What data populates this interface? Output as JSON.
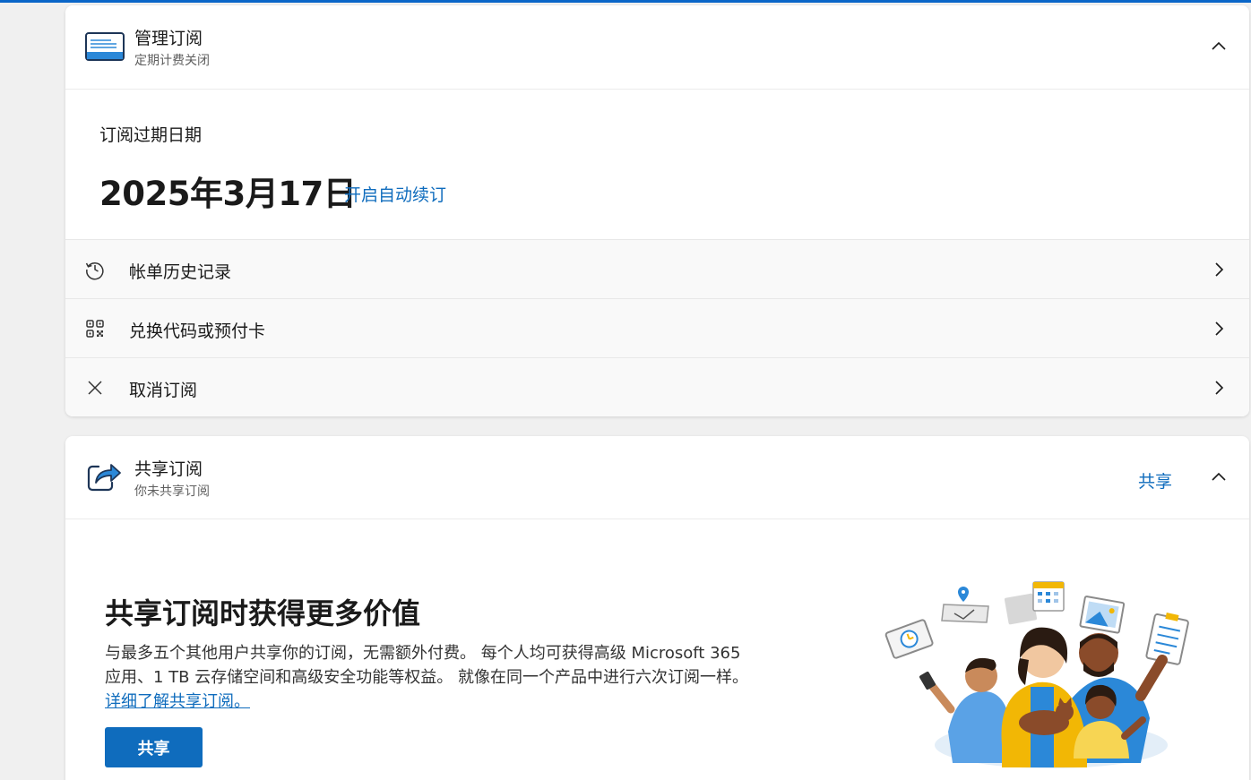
{
  "manage": {
    "title": "管理订阅",
    "subtitle": "定期计费关闭",
    "icon": "card-icon",
    "expiry_label": "订阅过期日期",
    "expiry_date": "2025年3月17日",
    "autorenew_link": "开启自动续订",
    "rows": [
      {
        "icon": "history-icon",
        "label": "帐单历史记录"
      },
      {
        "icon": "qr-code-icon",
        "label": "兑换代码或预付卡"
      },
      {
        "icon": "close-icon",
        "label": "取消订阅"
      }
    ]
  },
  "share": {
    "title": "共享订阅",
    "subtitle": "你未共享订阅",
    "header_link": "共享",
    "icon": "share-icon",
    "promo_title": "共享订阅时获得更多价值",
    "promo_body": "与最多五个其他用户共享你的订阅，无需额外付费。 每个人均可获得高级 Microsoft 365 应用、1 TB 云存储空间和高级安全功能等权益。 就像在同一个产品中进行六次订阅一样。",
    "learn_more": "详细了解共享订阅。",
    "button": "共享"
  },
  "colors": {
    "accent": "#0f6cbd",
    "background": "#f0f0f0",
    "card": "#ffffff",
    "row": "#f9f9f9"
  }
}
